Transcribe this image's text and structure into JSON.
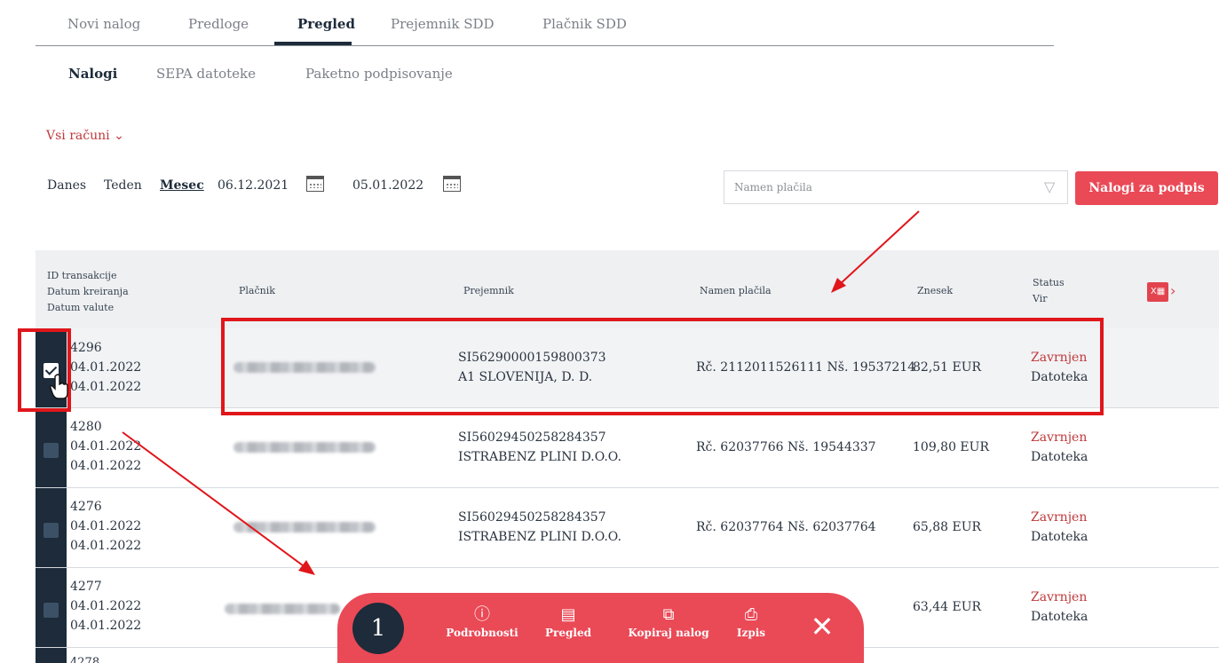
{
  "main_tabs": [
    "Novi nalog",
    "Predloge",
    "Pregled",
    "Prejemnik SDD",
    "Plačnik SDD"
  ],
  "sub_tabs": [
    "Nalogi",
    "SEPA datoteke",
    "Paketno podpisovanje"
  ],
  "account_filter": "Vsi računi ⌄",
  "date_filter": {
    "today": "Danes",
    "week": "Teden",
    "month": "Mesec",
    "from": "06.12.2021",
    "to": "05.01.2022"
  },
  "search": {
    "placeholder": "Namen plačila"
  },
  "sign_button": "Nalogi za podpis",
  "table": {
    "headers": {
      "id": [
        "ID transakcije",
        "Datum kreiranja",
        "Datum valute"
      ],
      "payer": "Plačnik",
      "recipient": "Prejemnik",
      "purpose": "Namen plačila",
      "amount": "Znesek",
      "status": [
        "Status",
        "Vir"
      ]
    },
    "rows": [
      {
        "id": "4296",
        "created": "04.01.2022",
        "value_date": "04.01.2022",
        "recipient_iban": "SI56290000159800373",
        "recipient_name": "A1 SLOVENIJA, D. D.",
        "purpose": "Rč. 2112011526111 Nš. 19537214",
        "amount": "82,51 EUR",
        "status": "Zavrnjen",
        "source": "Datoteka"
      },
      {
        "id": "4280",
        "created": "04.01.2022",
        "value_date": "04.01.2022",
        "recipient_iban": "SI56029450258284357",
        "recipient_name": "ISTRABENZ PLINI D.O.O.",
        "purpose": "Rč. 62037766 Nš. 19544337",
        "amount": "109,80 EUR",
        "status": "Zavrnjen",
        "source": "Datoteka"
      },
      {
        "id": "4276",
        "created": "04.01.2022",
        "value_date": "04.01.2022",
        "recipient_iban": "SI56029450258284357",
        "recipient_name": "ISTRABENZ PLINI D.O.O.",
        "purpose": "Rč. 62037764 Nš. 62037764",
        "amount": "65,88 EUR",
        "status": "Zavrnjen",
        "source": "Datoteka"
      },
      {
        "id": "4277",
        "created": "04.01.2022",
        "value_date": "04.01.2022",
        "recipient_iban": "",
        "recipient_name": "",
        "purpose": "",
        "amount": "63,44 EUR",
        "status": "Zavrnjen",
        "source": "Datoteka"
      }
    ],
    "partial_next_id": "4278"
  },
  "action_bar": {
    "selected_count": "1",
    "actions": [
      "Podrobnosti",
      "Pregled",
      "Kopiraj nalog",
      "Izpis"
    ]
  },
  "colors": {
    "accent": "#ea4956",
    "navy": "#1d2b3a",
    "rejected": "#c0393b",
    "annotation": "#e0161b"
  }
}
